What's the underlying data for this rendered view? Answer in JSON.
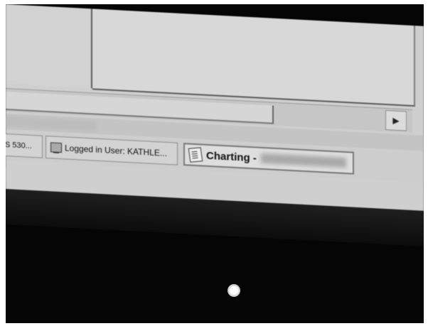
{
  "window": {
    "scroll_right_glyph": "▶"
  },
  "taskbar": {
    "items": [
      {
        "label": "S 530..."
      },
      {
        "label": "Logged in User: KATHLE..."
      },
      {
        "label": "Charting -"
      }
    ]
  },
  "icons": {
    "user_icon": "computer-icon",
    "charting_icon": "notepad-icon"
  }
}
